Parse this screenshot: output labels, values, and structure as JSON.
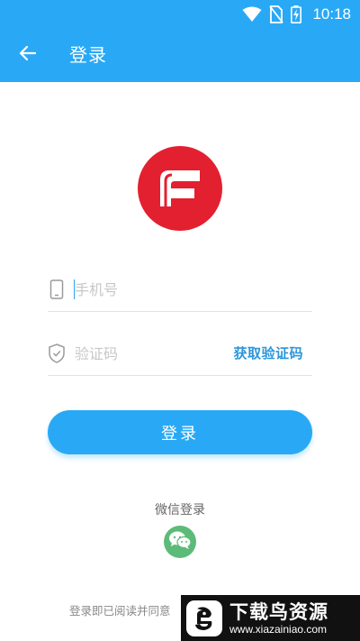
{
  "status_bar": {
    "time": "10:18",
    "icons": [
      "wifi-icon",
      "no-sim-icon",
      "battery-charging-icon"
    ]
  },
  "header": {
    "title": "登录",
    "back_icon": "arrow-left-icon"
  },
  "brand": {
    "logo_letter": "F",
    "logo_color": "#e3202f"
  },
  "form": {
    "phone": {
      "placeholder": "手机号",
      "value": "",
      "icon": "phone-icon"
    },
    "code": {
      "placeholder": "验证码",
      "value": "",
      "icon": "shield-icon",
      "get_code_label": "获取验证码"
    },
    "login_label": "登录"
  },
  "wechat": {
    "label": "微信登录",
    "icon": "wechat-icon"
  },
  "footer": {
    "agreement_text": "登录即已阅读并同意",
    "watermark": {
      "title": "下载鸟资源",
      "url": "www.xiazainiao.com"
    }
  },
  "colors": {
    "primary": "#29a9f5",
    "wechat": "#5dbb79",
    "link": "#2a96db"
  }
}
